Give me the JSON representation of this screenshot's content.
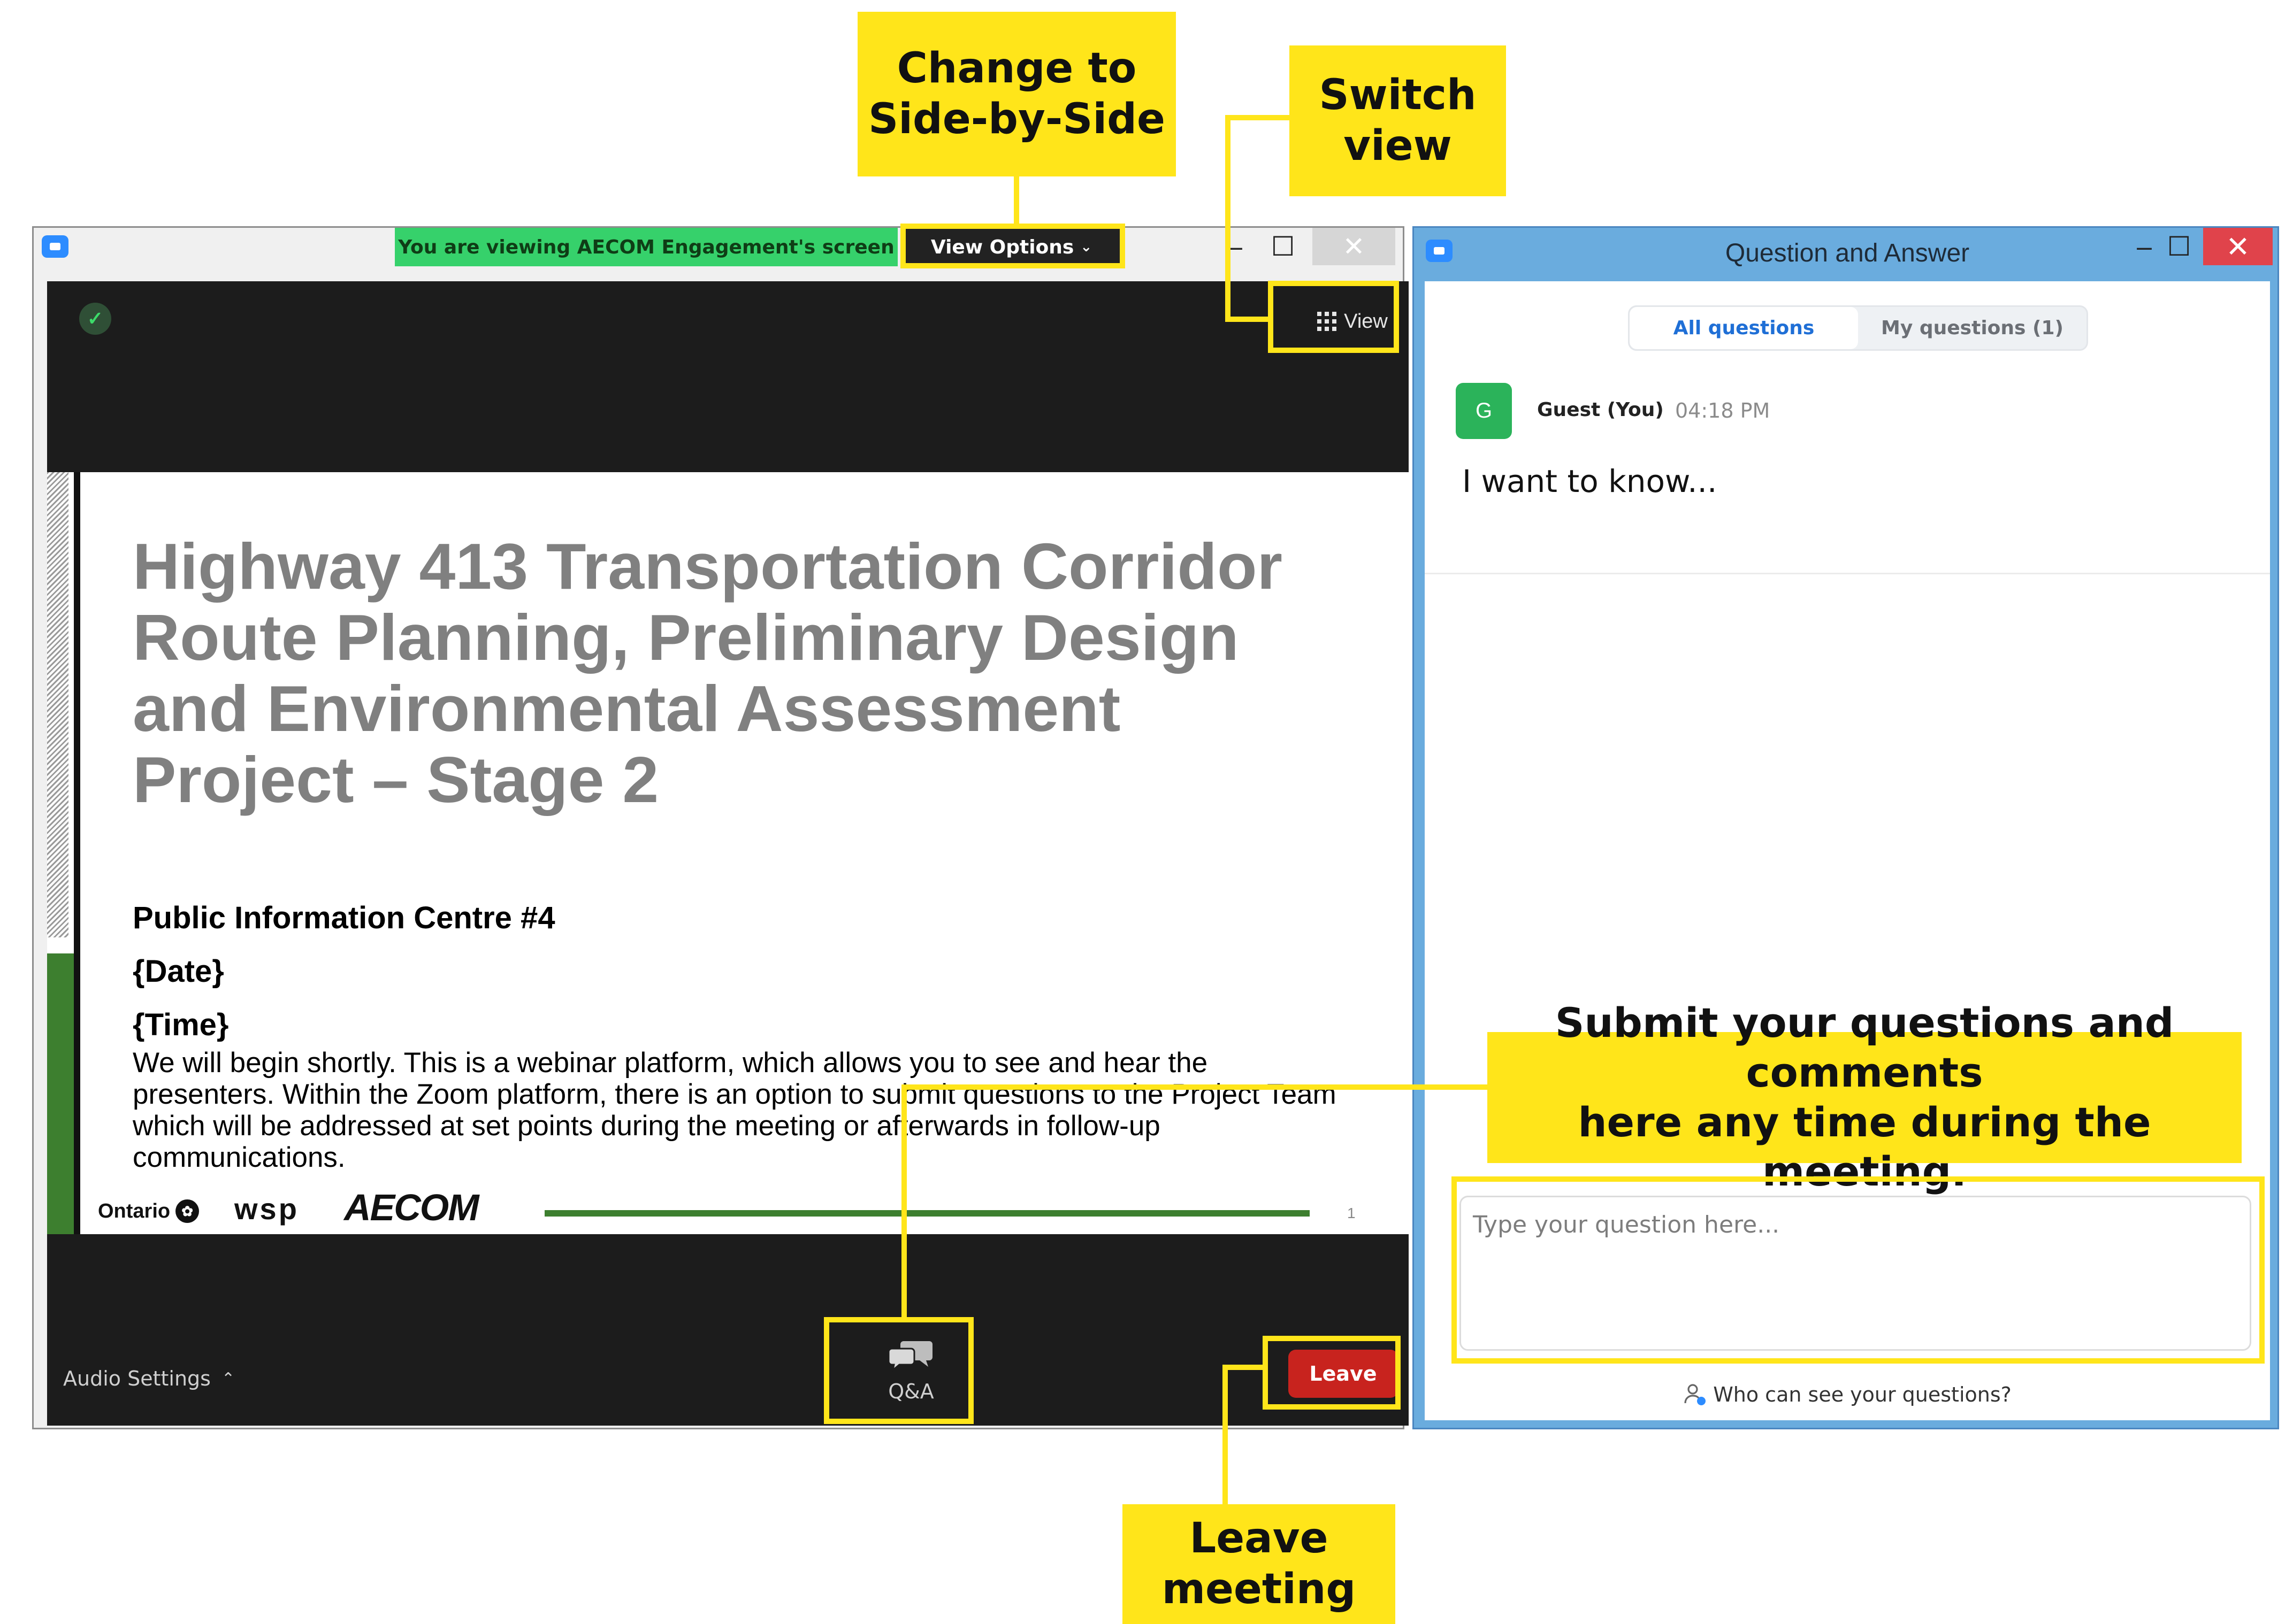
{
  "callouts": {
    "side_by_side": "Change to\nSide-by-Side",
    "switch_view": "Switch\nview",
    "submit_questions": "Submit your questions and comments\nhere any time during the meeting.",
    "leave_meeting": "Leave\nmeeting"
  },
  "zoom": {
    "share_banner": "You are viewing AECOM Engagement's screen",
    "view_options_label": "View Options",
    "view_button_label": "View",
    "audio_settings_label": "Audio Settings",
    "qa_button_label": "Q&A",
    "leave_button_label": "Leave",
    "titlebar": {
      "minimize": "–",
      "maximize": "☐",
      "close": "✕"
    }
  },
  "slide": {
    "title": "Highway 413 Transportation Corridor\nRoute Planning, Preliminary Design\nand Environmental Assessment\nProject – Stage 2",
    "subtitle": "Public Information Centre #4",
    "date": "{Date}",
    "time": "{Time}",
    "body": "We will begin shortly. This is a webinar platform, which allows you to see and hear the presenters. Within the Zoom platform, there is an option to submit questions to the Project Team which will be addressed at set points during the meeting or afterwards in follow-up communications.",
    "footer": {
      "ontario": "Ontario",
      "wsp": "wsp",
      "aecom": "AECOM",
      "page_number": "1"
    }
  },
  "qa_window": {
    "title": "Question and Answer",
    "tabs": [
      {
        "label": "All questions",
        "active": true
      },
      {
        "label": "My questions (1)",
        "active": false
      }
    ],
    "question": {
      "avatar_letter": "G",
      "author": "Guest (You)",
      "time": "04:18 PM",
      "text": "I want to know..."
    },
    "input_placeholder": "Type your question here...",
    "who_can_see": "Who can see your questions?"
  },
  "colors": {
    "highlight": "#ffe51a",
    "banner_green": "#36d16b",
    "leave_red": "#c8231e",
    "qa_titlebar_blue": "#6aacde",
    "active_tab_blue": "#1f6fd6",
    "avatar_green": "#2bb35a",
    "slide_green": "#3d7f2f"
  },
  "icons": [
    "zoom-app-icon",
    "shield-check-icon",
    "grid-view-icon",
    "chevron-down-icon",
    "chevron-up-icon",
    "chat-bubbles-icon",
    "person-visibility-icon"
  ]
}
